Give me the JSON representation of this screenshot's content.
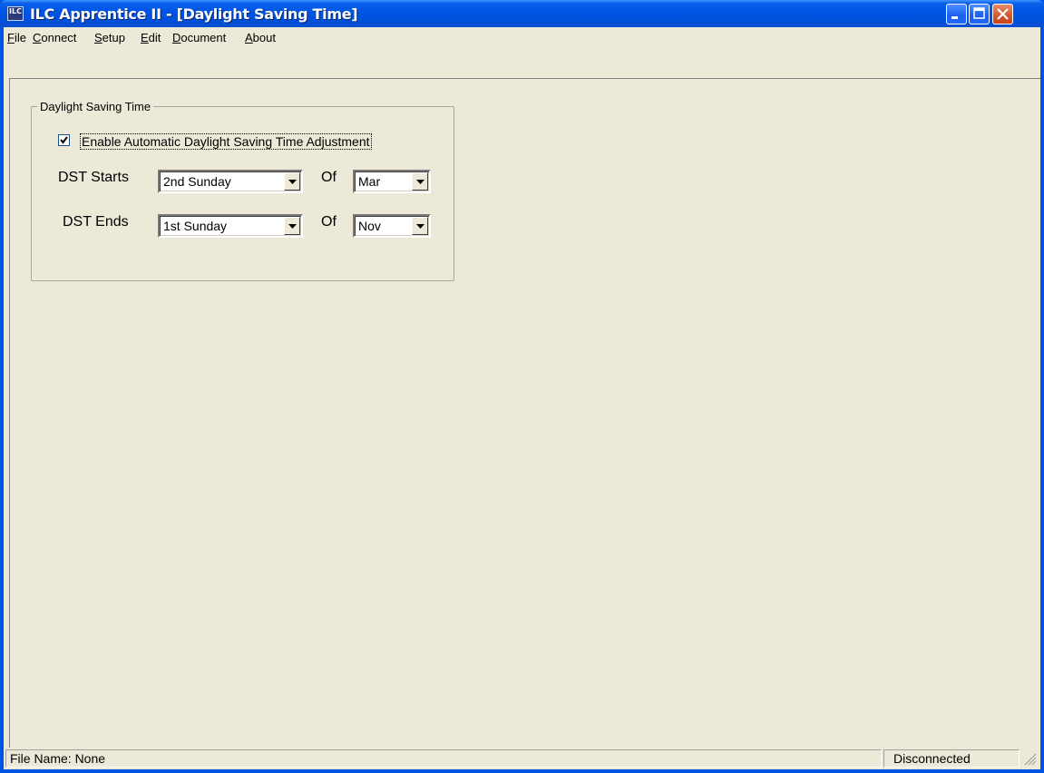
{
  "window": {
    "title": "ILC Apprentice II - [Daylight Saving Time]",
    "icon_text": "ILC"
  },
  "menu": [
    {
      "label": "ile",
      "accel": "F"
    },
    {
      "label": "onnect",
      "accel": "C"
    },
    {
      "label": "etup",
      "accel": "S"
    },
    {
      "label": "dit",
      "accel": "E"
    },
    {
      "label": "ocument",
      "accel": "D"
    },
    {
      "label": "bout",
      "accel": "A"
    }
  ],
  "dst": {
    "group_title": "Daylight Saving Time",
    "enable_label": "Enable Automatic Daylight Saving Time Adjustment",
    "enable_checked": true,
    "starts_label": "DST Starts",
    "starts_week": "2nd Sunday",
    "starts_month": "Mar",
    "ends_label": "DST Ends",
    "ends_week": "1st Sunday",
    "ends_month": "Nov",
    "of_label": "Of"
  },
  "status": {
    "file_name": "File Name: None",
    "connection": "Disconnected"
  },
  "colors": {
    "titlebar": "#0055e5",
    "face": "#ece9d8",
    "close": "#d55a30"
  }
}
